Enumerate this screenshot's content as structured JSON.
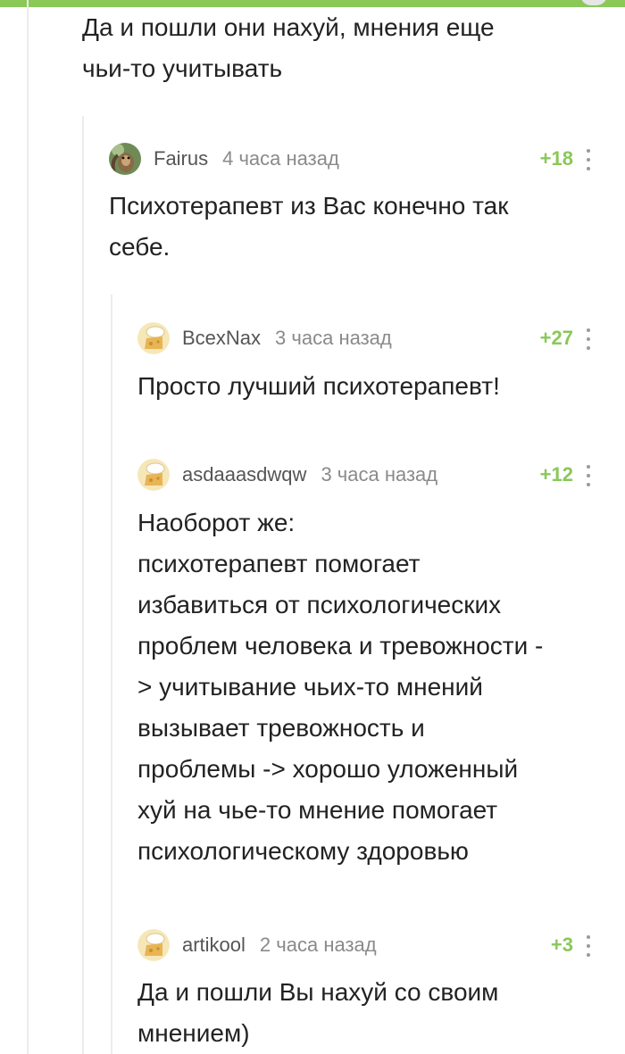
{
  "top_comment": {
    "text": "Да и пошли они нахуй, мнения еще\nчьи-то учитывать"
  },
  "comments": [
    {
      "user": "Fairus",
      "time": "4 часа назад",
      "rating": "+18",
      "avatar_icon": "squirrel-avatar-icon",
      "text": "Психотерапевт из Вас конечно так\nсебе."
    },
    {
      "user": "BcexNax",
      "time": "3 часа назад",
      "rating": "+27",
      "avatar_icon": "default-cheese-avatar-icon",
      "text": "Просто лучший психотерапевт!"
    },
    {
      "user": "asdaaasdwqw",
      "time": "3 часа назад",
      "rating": "+12",
      "avatar_icon": "default-cheese-avatar-icon",
      "text": "Наоборот же:\nпсихотерапевт помогает\nизбавиться от психологических\nпроблем человека и тревожности -\n> учитывание чьих-то мнений\nвызывает тревожность и\nпроблемы -> хорошо уложенный\nхуй на чье-то мнение помогает\nпсихологическому здоровью"
    },
    {
      "user": "artikool",
      "time": "2 часа назад",
      "rating": "+3",
      "avatar_icon": "default-cheese-avatar-icon",
      "text": "Да и пошли Вы нахуй со своим\nмнением)"
    }
  ],
  "colors": {
    "accent": "#8ac858",
    "thread_line": "#ececec",
    "username": "#555555",
    "time": "#8a8a8a"
  }
}
